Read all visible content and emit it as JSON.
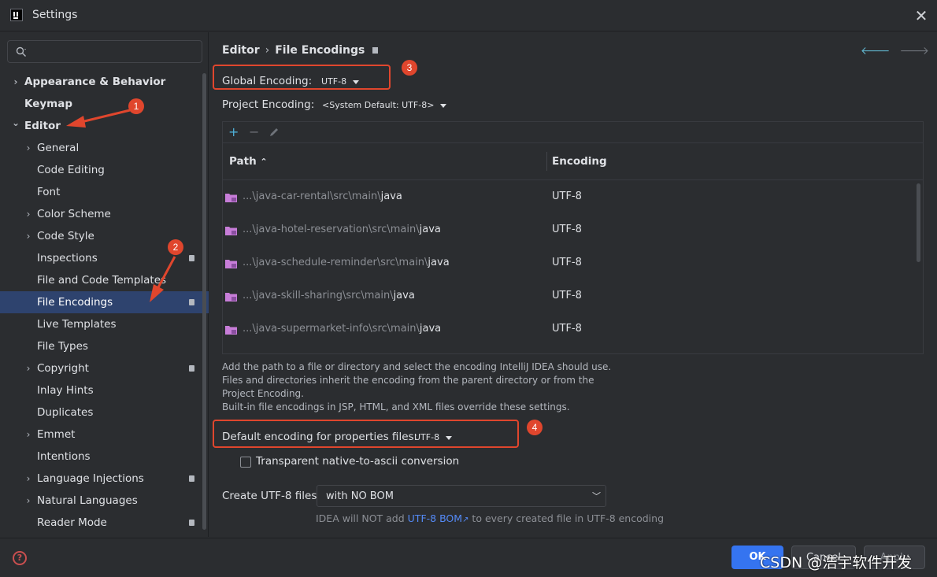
{
  "window": {
    "title": "Settings"
  },
  "sidebar": {
    "items": [
      {
        "label": "Appearance & Behavior",
        "level": 0,
        "expandable": true,
        "expanded": false,
        "bold": true
      },
      {
        "label": "Keymap",
        "level": 0,
        "expandable": false,
        "bold": true
      },
      {
        "label": "Editor",
        "level": 0,
        "expandable": true,
        "expanded": true,
        "bold": true
      },
      {
        "label": "General",
        "level": 1,
        "expandable": true
      },
      {
        "label": "Code Editing",
        "level": 1
      },
      {
        "label": "Font",
        "level": 1
      },
      {
        "label": "Color Scheme",
        "level": 1,
        "expandable": true
      },
      {
        "label": "Code Style",
        "level": 1,
        "expandable": true
      },
      {
        "label": "Inspections",
        "level": 1,
        "badge": true
      },
      {
        "label": "File and Code Templates",
        "level": 1
      },
      {
        "label": "File Encodings",
        "level": 1,
        "badge": true,
        "selected": true
      },
      {
        "label": "Live Templates",
        "level": 1
      },
      {
        "label": "File Types",
        "level": 1
      },
      {
        "label": "Copyright",
        "level": 1,
        "expandable": true,
        "badge": true
      },
      {
        "label": "Inlay Hints",
        "level": 1
      },
      {
        "label": "Duplicates",
        "level": 1
      },
      {
        "label": "Emmet",
        "level": 1,
        "expandable": true
      },
      {
        "label": "Intentions",
        "level": 1
      },
      {
        "label": "Language Injections",
        "level": 1,
        "expandable": true,
        "badge": true
      },
      {
        "label": "Natural Languages",
        "level": 1,
        "expandable": true
      },
      {
        "label": "Reader Mode",
        "level": 1,
        "badge": true
      }
    ]
  },
  "breadcrumb": {
    "parent": "Editor",
    "separator": "›",
    "current": "File Encodings"
  },
  "global_encoding": {
    "label": "Global Encoding:",
    "value": "UTF-8"
  },
  "project_encoding": {
    "label": "Project Encoding:",
    "value": "<System Default: UTF-8>"
  },
  "table": {
    "columns": [
      "Path",
      "Encoding"
    ],
    "rows": [
      {
        "path_prefix": "...\\java-car-rental\\src\\main\\",
        "path_leaf": "java",
        "encoding": "UTF-8"
      },
      {
        "path_prefix": "...\\java-hotel-reservation\\src\\main\\",
        "path_leaf": "java",
        "encoding": "UTF-8"
      },
      {
        "path_prefix": "...\\java-schedule-reminder\\src\\main\\",
        "path_leaf": "java",
        "encoding": "UTF-8"
      },
      {
        "path_prefix": "...\\java-skill-sharing\\src\\main\\",
        "path_leaf": "java",
        "encoding": "UTF-8"
      },
      {
        "path_prefix": "...\\java-supermarket-info\\src\\main\\",
        "path_leaf": "java",
        "encoding": "UTF-8"
      }
    ]
  },
  "hint": {
    "line1": "Add the path to a file or directory and select the encoding IntelliJ IDEA should use.",
    "line2": "Files and directories inherit the encoding from the parent directory or from the",
    "line3": "Project Encoding.",
    "line4": "Built-in file encodings in JSP, HTML, and XML files override these settings."
  },
  "properties_encoding": {
    "label": "Default encoding for properties files:",
    "value": "UTF-8"
  },
  "transparent_ascii": {
    "label": "Transparent native-to-ascii conversion",
    "checked": false
  },
  "create_utf8": {
    "label": "Create UTF-8 files:",
    "value": "with NO BOM"
  },
  "bom_note": {
    "prefix": "IDEA will NOT add ",
    "link": "UTF-8 BOM",
    "suffix": " to every created file in UTF-8 encoding"
  },
  "footer": {
    "ok": "OK",
    "cancel": "Cancel",
    "apply": "Apply",
    "watermark": "CSDN @浩宇软件开发"
  },
  "annotations": [
    "1",
    "2",
    "3",
    "4"
  ],
  "colors": {
    "accent": "#3574f0",
    "selection": "#2e436e",
    "annotation": "#e0462d",
    "folder": "#c77dd8"
  }
}
